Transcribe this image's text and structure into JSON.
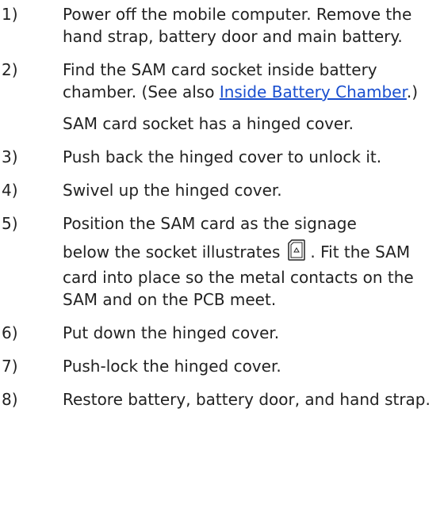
{
  "steps": [
    {
      "number": "1)",
      "text": "Power off the mobile computer. Remove the hand strap, battery door and main battery."
    },
    {
      "number": "2)",
      "text_before_link": "Find the SAM card socket inside battery chamber. (See also ",
      "link_text": "Inside Battery Chamber",
      "text_after_link": ".)",
      "note": "SAM card socket has a hinged cover."
    },
    {
      "number": "3)",
      "text": "Push back the hinged cover to unlock it."
    },
    {
      "number": "4)",
      "text": "Swivel up the hinged cover."
    },
    {
      "number": "5)",
      "text_line1": "Position the SAM card as the signage",
      "text_before_icon": "below the socket illustrates",
      "icon": "sam-card-signage-icon",
      "text_after_icon": ". Fit the SAM card into place so the metal contacts on the SAM and on the PCB meet."
    },
    {
      "number": "6)",
      "text": "Put down the hinged cover."
    },
    {
      "number": "7)",
      "text": "Push-lock the hinged cover."
    },
    {
      "number": "8)",
      "text": "Restore battery, battery door, and hand strap."
    }
  ],
  "colors": {
    "text": "#222222",
    "link": "#1a4fcf"
  }
}
